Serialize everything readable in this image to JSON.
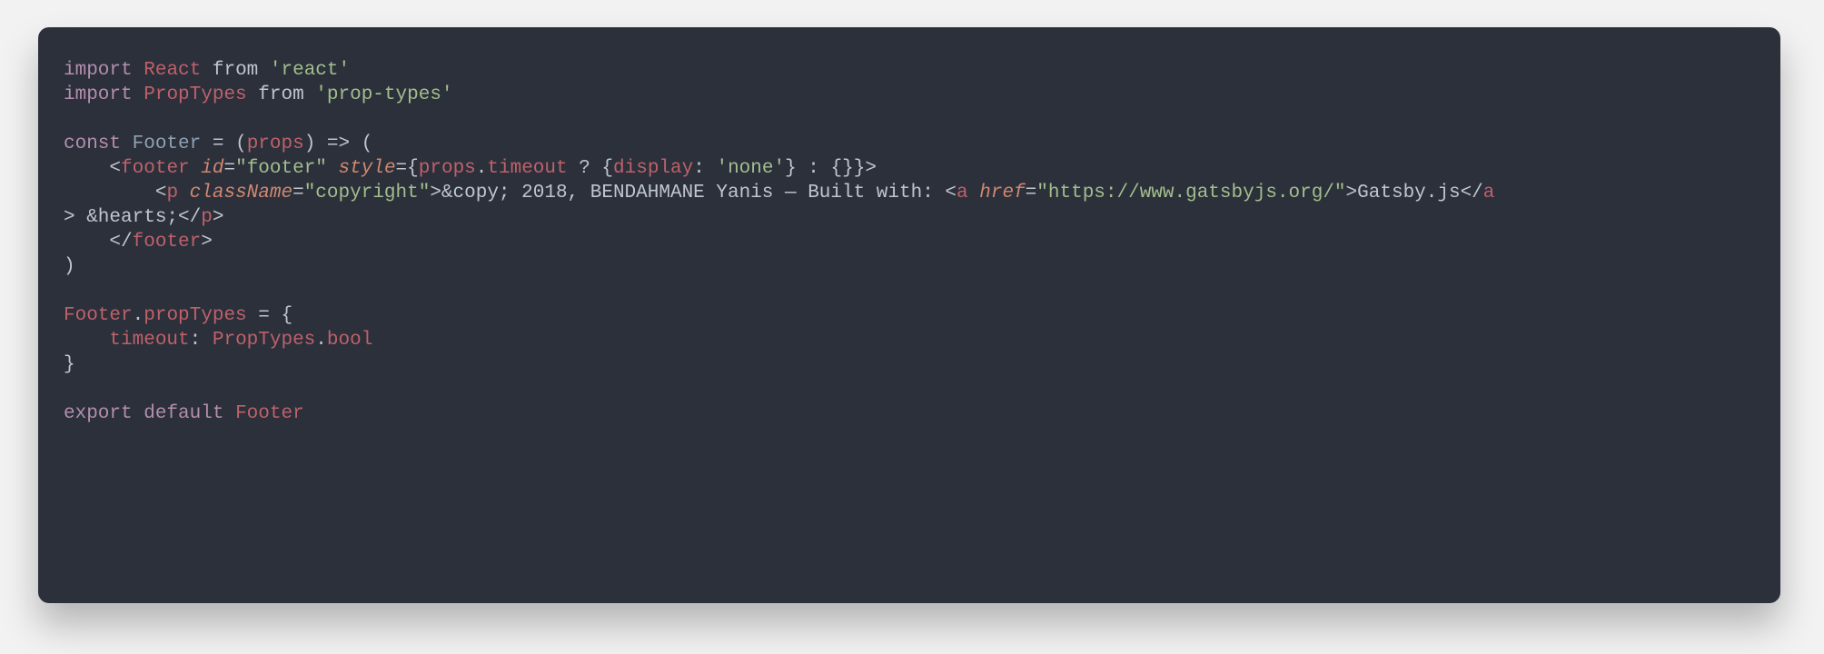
{
  "code": {
    "l1": {
      "kw1": "import",
      "ident": "React",
      "from": "from",
      "str": "'react'"
    },
    "l2": {
      "kw1": "import",
      "ident": "PropTypes",
      "from": "from",
      "str": "'prop-types'"
    },
    "l4": {
      "kw": "const",
      "name": "Footer",
      "eq": "=",
      "lp": "(",
      "param": "props",
      "rp": ")",
      "arrow": "=>",
      "open": "("
    },
    "l5": {
      "indent": "    ",
      "lt": "<",
      "tag": "footer",
      "sp": " ",
      "attr1": "id",
      "eq1": "=",
      "val1": "\"footer\"",
      "attr2": "style",
      "eq2": "=",
      "lb": "{",
      "props": "props",
      "dot": ".",
      "timeout": "timeout",
      "q": " ? ",
      "lb2": "{",
      "dispkey": "display",
      "colon": ": ",
      "none": "'none'",
      "rb2": "}",
      "col2": " : ",
      "empty": "{}",
      "rb": "}",
      "gt": ">"
    },
    "l6a": {
      "indent": "        ",
      "lt": "<",
      "tag": "p",
      "sp": " ",
      "attr": "className",
      "eq": "=",
      "val": "\"copyright\"",
      "gt": ">",
      "text1": "&copy; 2018, BENDAHMANE Yanis — Built with: ",
      "lt2": "<",
      "tag2": "a",
      "sp2": " ",
      "attr2": "href",
      "eq2": "=",
      "val2": "\"https://www.gatsbyjs.org/\"",
      "gt2": ">",
      "linktext": "Gatsby.js",
      "cl_a_open": "</",
      "cl_a_tag": "a",
      "cl_a_end": ""
    },
    "l6b": {
      "wraptext": "> &hearts;",
      "cl_p_open": "</",
      "cl_p_tag": "p",
      "cl_p_gt": ">"
    },
    "l7": {
      "indent": "    ",
      "open": "</",
      "tag": "footer",
      "gt": ">"
    },
    "l8": {
      "close": ")"
    },
    "l10": {
      "name": "Footer",
      "dot": ".",
      "prop": "propTypes",
      "rest": " = {"
    },
    "l11": {
      "indent": "    ",
      "key": "timeout",
      "colon": ": ",
      "pt": "PropTypes",
      "dot": ".",
      "bool": "bool"
    },
    "l12": {
      "close": "}"
    },
    "l14": {
      "kw1": "export",
      "kw2": "default",
      "name": "Footer"
    }
  }
}
